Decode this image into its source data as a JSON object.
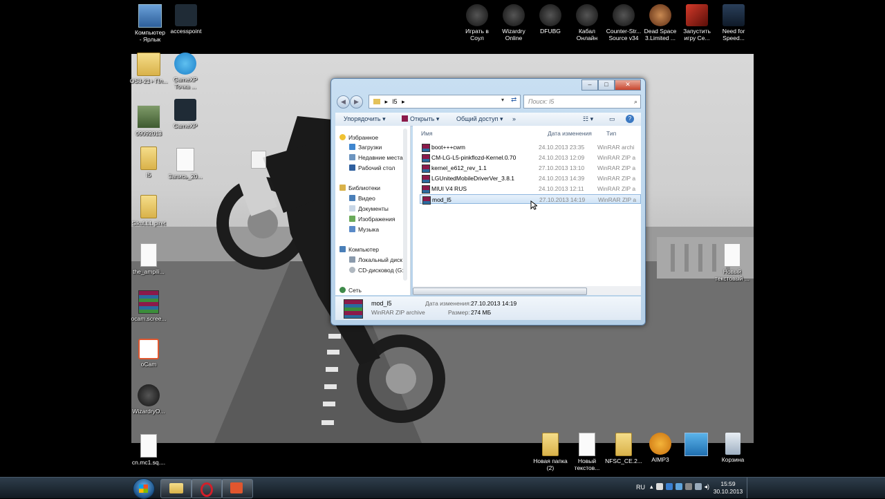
{
  "desktop_top_left": [
    {
      "id": "computer",
      "label": "Компьютер\n- Ярлык"
    },
    {
      "id": "accesspoint",
      "label": "accesspoint"
    }
  ],
  "desktop_left": [
    {
      "id": "d1",
      "label": "OS3-21+ Пл..."
    },
    {
      "id": "d2",
      "label": "GameXP\nТочка ..."
    },
    {
      "id": "d3",
      "label": "09092013"
    },
    {
      "id": "d4",
      "label": "GameXP"
    },
    {
      "id": "d5",
      "label": "l5"
    },
    {
      "id": "d6",
      "label": "Запись_20..."
    },
    {
      "id": "d7",
      "label": "SikuLLL piret"
    },
    {
      "id": "d8",
      "label": "the_ampili..."
    },
    {
      "id": "d9",
      "label": "ocam.scree..."
    },
    {
      "id": "d10",
      "label": "oCam"
    },
    {
      "id": "d11",
      "label": "WizardryO..."
    },
    {
      "id": "d12",
      "label": "cn.mc1.sq...."
    }
  ],
  "desktop_top_right": [
    {
      "id": "soul",
      "label": "Играть в\nСоул"
    },
    {
      "id": "wizardry",
      "label": "Wizardry\nOnline"
    },
    {
      "id": "dfubg",
      "label": "DFUBG"
    },
    {
      "id": "kabal",
      "label": "Кабал\nОнлайн"
    },
    {
      "id": "cs",
      "label": "Counter-Str...\nSource v34"
    },
    {
      "id": "deadspace",
      "label": "Dead Space\n3.Limited ..."
    },
    {
      "id": "launch",
      "label": "Запустить\nигру Се..."
    },
    {
      "id": "nfs",
      "label": "Need for\nSpeed..."
    }
  ],
  "desktop_right": {
    "label": "Новый\nтекстовый ..."
  },
  "desktop_bottom": [
    {
      "id": "b1",
      "label": "Новая папка\n(2)"
    },
    {
      "id": "b2",
      "label": "Новый\nтекстов..."
    },
    {
      "id": "b3",
      "label": "NFSC_CE.2..."
    },
    {
      "id": "b4",
      "label": "AIMP3"
    },
    {
      "id": "b5",
      "label": ""
    },
    {
      "id": "b6",
      "label": "Корзина"
    }
  ],
  "explorer": {
    "address": "l5",
    "search_placeholder": "Поиск: l5",
    "toolbar": {
      "organize": "Упорядочить",
      "open": "Открыть",
      "share": "Общий доступ",
      "more": "»"
    },
    "nav": {
      "favorites": "Избранное",
      "downloads": "Загрузки",
      "recent": "Недавние места",
      "desktop": "Рабочий стол",
      "libraries": "Библиотеки",
      "video": "Видео",
      "documents": "Документы",
      "pictures": "Изображения",
      "music": "Музыка",
      "computer": "Компьютер",
      "local_disk": "Локальный диск",
      "cd_drive": "CD-дисковод (G:",
      "network": "Сеть"
    },
    "columns": {
      "name": "Имя",
      "date": "Дата изменения",
      "type": "Тип"
    },
    "files": [
      {
        "name": "boot+++cwm",
        "date": "24.10.2013 23:35",
        "type": "WinRAR archi"
      },
      {
        "name": "CM-LG-L5-pinkflozd-Kernel.0.70",
        "date": "24.10.2013 12:09",
        "type": "WinRAR ZIP a"
      },
      {
        "name": "kernel_e612_rev_1.1",
        "date": "27.10.2013 13:10",
        "type": "WinRAR ZIP a"
      },
      {
        "name": "LGUnitedMobileDriverVer_3.8.1",
        "date": "24.10.2013 14:39",
        "type": "WinRAR ZIP a"
      },
      {
        "name": "MIUI V4 RUS",
        "date": "24.10.2013 12:11",
        "type": "WinRAR ZIP a"
      },
      {
        "name": "mod_l5",
        "date": "27.10.2013 14:19",
        "type": "WinRAR ZIP a"
      }
    ],
    "details": {
      "name": "mod_l5",
      "type": "WinRAR ZIP archive",
      "date_label": "Дата изменения:",
      "date_value": "27.10.2013 14:19",
      "size_label": "Размер:",
      "size_value": "274 МБ"
    }
  },
  "taskbar": {
    "lang": "RU",
    "time": "15:59",
    "date": "30.10.2013"
  }
}
